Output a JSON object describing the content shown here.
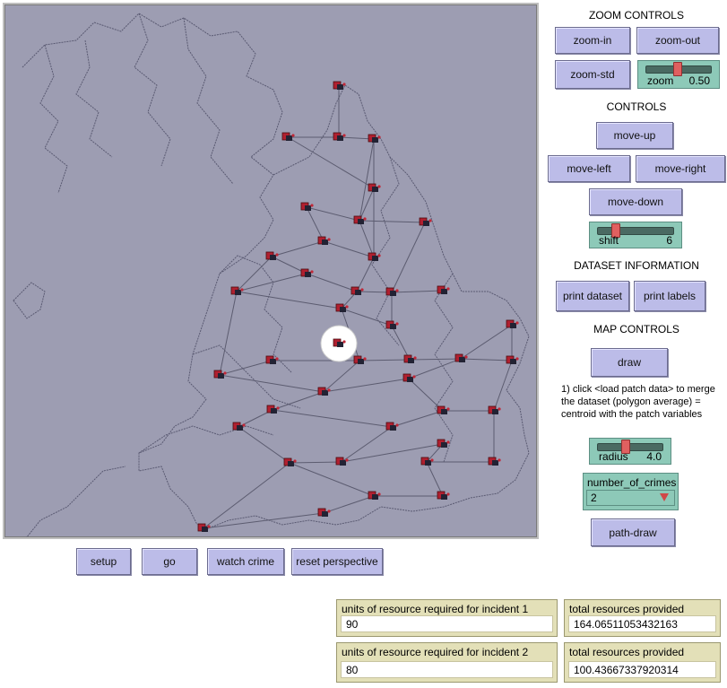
{
  "zoom_controls": {
    "title": "ZOOM CONTROLS",
    "zoom_in": "zoom-in",
    "zoom_out": "zoom-out",
    "zoom_std": "zoom-std",
    "zoom_slider": {
      "label": "zoom",
      "value": "0.50",
      "fraction": 0.45
    }
  },
  "controls": {
    "title": "CONTROLS",
    "move_up": "move-up",
    "move_left": "move-left",
    "move_right": "move-right",
    "move_down": "move-down",
    "shift_slider": {
      "label": "shift",
      "value": "6",
      "fraction": 0.2
    }
  },
  "dataset_info": {
    "title": "DATASET INFORMATION",
    "print_dataset": "print dataset",
    "print_labels": "print labels"
  },
  "map_controls": {
    "title": "MAP CONTROLS",
    "draw": "draw",
    "note": "1) click <load patch data> to merge the dataset (polygon average) = centroid with the patch variables",
    "radius_slider": {
      "label": "radius",
      "value": "4.0",
      "fraction": 0.4
    },
    "chooser": {
      "label": "number_of_crimes",
      "value": "2"
    },
    "path_draw": "path-draw"
  },
  "bottom_buttons": {
    "setup": "setup",
    "go": "go",
    "watch_crime": "watch crime",
    "reset_perspective": "reset perspective"
  },
  "monitors": [
    {
      "label": "units of resource required for incident 1",
      "value": "90"
    },
    {
      "label": "total resources provided",
      "value": "164.06511053432163"
    },
    {
      "label": "units of resource required for incident 2",
      "value": "80"
    },
    {
      "label": "total resources provided",
      "value": "100.43667337920314"
    }
  ],
  "colors": {
    "map_background": "#9d9db2",
    "button": "#bcbce8",
    "slider": "#8dc9b8",
    "monitor": "#e3e0b8",
    "highlight_circle": "#ffffff",
    "agent_red": "#b02030"
  }
}
